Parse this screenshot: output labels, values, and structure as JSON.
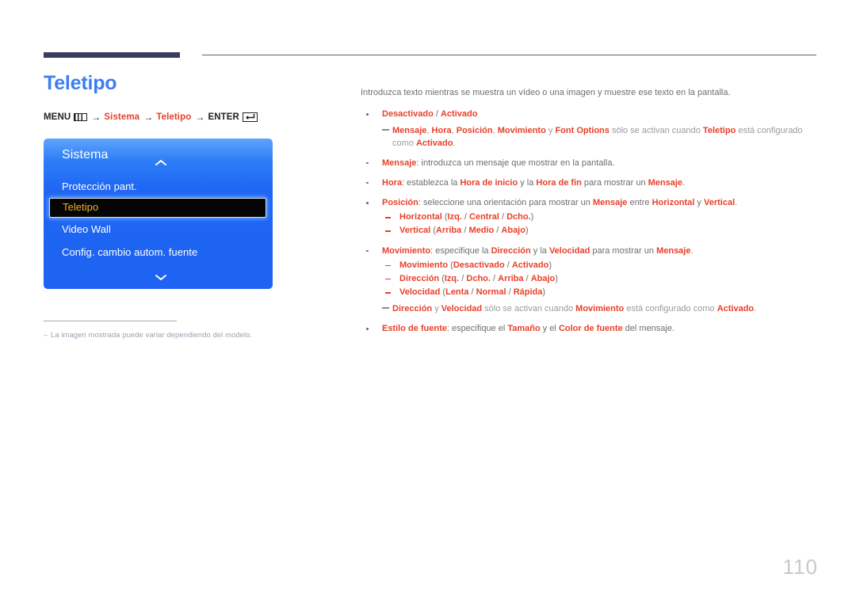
{
  "page": {
    "title": "Teletipo",
    "number": "110",
    "title_color": "#3c7ef0",
    "accent_red": "#e8402a",
    "rule_color": "#383e5f"
  },
  "breadcrumb": {
    "menu_label": "MENU",
    "menu_icon": "menu-bars-icon",
    "arrow": "→",
    "item1": "Sistema",
    "item2": "Teletipo",
    "enter_label": "ENTER",
    "enter_icon": "enter-return-icon"
  },
  "osd": {
    "title": "Sistema",
    "scroll_up_icon": "chevron-up-icon",
    "scroll_down_icon": "chevron-down-icon",
    "items": [
      {
        "label": "Protección pant.",
        "selected": false
      },
      {
        "label": "Teletipo",
        "selected": true
      },
      {
        "label": "Video Wall",
        "selected": false
      },
      {
        "label": "Config. cambio autom. fuente",
        "selected": false
      }
    ],
    "panel_color_top": "#5fa4fb",
    "panel_color_bottom": "#1e63f2",
    "selected_text_color": "#f2b12a",
    "selected_bg_color": "#050505"
  },
  "footnote": {
    "dash": "–",
    "text": "La imagen mostrada puede variar dependiendo del modelo."
  },
  "content": {
    "intro": "Introduzca texto mientras se muestra un vídeo o una imagen y muestre ese texto en la pantalla.",
    "bullets": [
      {
        "id": "desactivado-activado",
        "parts": [
          {
            "t": "Desactivado",
            "s": "r"
          },
          {
            "t": " / ",
            "s": "g"
          },
          {
            "t": "Activado",
            "s": "r"
          }
        ],
        "note": {
          "parts": [
            {
              "t": "Mensaje",
              "s": "r"
            },
            {
              "t": ", ",
              "s": "gl"
            },
            {
              "t": "Hora",
              "s": "r"
            },
            {
              "t": ", ",
              "s": "gl"
            },
            {
              "t": "Posición",
              "s": "r"
            },
            {
              "t": ", ",
              "s": "gl"
            },
            {
              "t": "Movimiento",
              "s": "r"
            },
            {
              "t": " y ",
              "s": "gl"
            },
            {
              "t": "Font Options",
              "s": "r"
            },
            {
              "t": " sólo se activan cuando ",
              "s": "gl"
            },
            {
              "t": "Teletipo",
              "s": "r"
            },
            {
              "t": " está configurado como ",
              "s": "gl"
            },
            {
              "t": "Activado",
              "s": "r"
            },
            {
              "t": ".",
              "s": "gl"
            }
          ],
          "wrap_at": 11
        },
        "sub": []
      },
      {
        "id": "mensaje",
        "parts": [
          {
            "t": "Mensaje",
            "s": "r"
          },
          {
            "t": ": introduzca un mensaje que mostrar en la pantalla.",
            "s": "g"
          }
        ],
        "sub": []
      },
      {
        "id": "hora",
        "parts": [
          {
            "t": "Hora",
            "s": "r"
          },
          {
            "t": ": establezca la ",
            "s": "g"
          },
          {
            "t": "Hora de inicio",
            "s": "r"
          },
          {
            "t": " y la ",
            "s": "g"
          },
          {
            "t": "Hora de fin",
            "s": "r"
          },
          {
            "t": " para mostrar un ",
            "s": "g"
          },
          {
            "t": "Mensaje",
            "s": "r"
          },
          {
            "t": ".",
            "s": "g"
          }
        ],
        "sub": []
      },
      {
        "id": "posicion",
        "parts": [
          {
            "t": "Posición",
            "s": "r"
          },
          {
            "t": ": seleccione una orientación para mostrar un ",
            "s": "g"
          },
          {
            "t": "Mensaje",
            "s": "r"
          },
          {
            "t": " entre ",
            "s": "g"
          },
          {
            "t": "Horizontal",
            "s": "r"
          },
          {
            "t": " y ",
            "s": "g"
          },
          {
            "t": "Vertical",
            "s": "r"
          },
          {
            "t": ".",
            "s": "g"
          }
        ],
        "sub": [
          {
            "parts": [
              {
                "t": "Horizontal",
                "s": "r"
              },
              {
                "t": " (",
                "s": "g"
              },
              {
                "t": "Izq.",
                "s": "r"
              },
              {
                "t": " / ",
                "s": "g"
              },
              {
                "t": "Central",
                "s": "r"
              },
              {
                "t": " / ",
                "s": "g"
              },
              {
                "t": "Dcho.",
                "s": "r"
              },
              {
                "t": ")",
                "s": "g"
              }
            ]
          },
          {
            "parts": [
              {
                "t": "Vertical",
                "s": "r"
              },
              {
                "t": " (",
                "s": "g"
              },
              {
                "t": "Arriba",
                "s": "r"
              },
              {
                "t": " / ",
                "s": "g"
              },
              {
                "t": "Medio",
                "s": "r"
              },
              {
                "t": " / ",
                "s": "g"
              },
              {
                "t": "Abajo",
                "s": "r"
              },
              {
                "t": ")",
                "s": "g"
              }
            ]
          }
        ]
      },
      {
        "id": "movimiento",
        "parts": [
          {
            "t": "Movimiento",
            "s": "r"
          },
          {
            "t": ": especifique la ",
            "s": "g"
          },
          {
            "t": "Dirección",
            "s": "r"
          },
          {
            "t": " y la ",
            "s": "g"
          },
          {
            "t": "Velocidad",
            "s": "r"
          },
          {
            "t": " para mostrar un ",
            "s": "g"
          },
          {
            "t": "Mensaje",
            "s": "r"
          },
          {
            "t": ".",
            "s": "g"
          }
        ],
        "sub": [
          {
            "parts": [
              {
                "t": "Movimiento",
                "s": "r"
              },
              {
                "t": " (",
                "s": "g"
              },
              {
                "t": "Desactivado",
                "s": "r"
              },
              {
                "t": " / ",
                "s": "g"
              },
              {
                "t": "Activado",
                "s": "r"
              },
              {
                "t": ")",
                "s": "g"
              }
            ]
          },
          {
            "parts": [
              {
                "t": "Dirección",
                "s": "r"
              },
              {
                "t": " (",
                "s": "g"
              },
              {
                "t": "Izq.",
                "s": "r"
              },
              {
                "t": " / ",
                "s": "g"
              },
              {
                "t": "Dcho.",
                "s": "r"
              },
              {
                "t": " / ",
                "s": "g"
              },
              {
                "t": "Arriba",
                "s": "r"
              },
              {
                "t": " / ",
                "s": "g"
              },
              {
                "t": "Abajo",
                "s": "r"
              },
              {
                "t": ")",
                "s": "g"
              }
            ]
          },
          {
            "parts": [
              {
                "t": "Velocidad",
                "s": "r"
              },
              {
                "t": " (",
                "s": "g"
              },
              {
                "t": "Lenta",
                "s": "r"
              },
              {
                "t": " / ",
                "s": "g"
              },
              {
                "t": "Normal",
                "s": "r"
              },
              {
                "t": " / ",
                "s": "g"
              },
              {
                "t": "Rápida",
                "s": "r"
              },
              {
                "t": ")",
                "s": "g"
              }
            ]
          }
        ],
        "note": {
          "parts": [
            {
              "t": "Dirección",
              "s": "r"
            },
            {
              "t": " y ",
              "s": "gl"
            },
            {
              "t": "Velocidad",
              "s": "r"
            },
            {
              "t": " sólo se activan cuando ",
              "s": "gl"
            },
            {
              "t": "Movimiento",
              "s": "r"
            },
            {
              "t": " está configurado como ",
              "s": "gl"
            },
            {
              "t": "Activado",
              "s": "r"
            },
            {
              "t": ".",
              "s": "gl"
            }
          ]
        }
      },
      {
        "id": "estilo-de-fuente",
        "parts": [
          {
            "t": "Estilo de fuente",
            "s": "r"
          },
          {
            "t": ": especifique el ",
            "s": "g"
          },
          {
            "t": "Tamaño",
            "s": "r"
          },
          {
            "t": " y el ",
            "s": "g"
          },
          {
            "t": "Color de fuente",
            "s": "r"
          },
          {
            "t": " del mensaje.",
            "s": "g"
          }
        ],
        "sub": []
      }
    ]
  }
}
